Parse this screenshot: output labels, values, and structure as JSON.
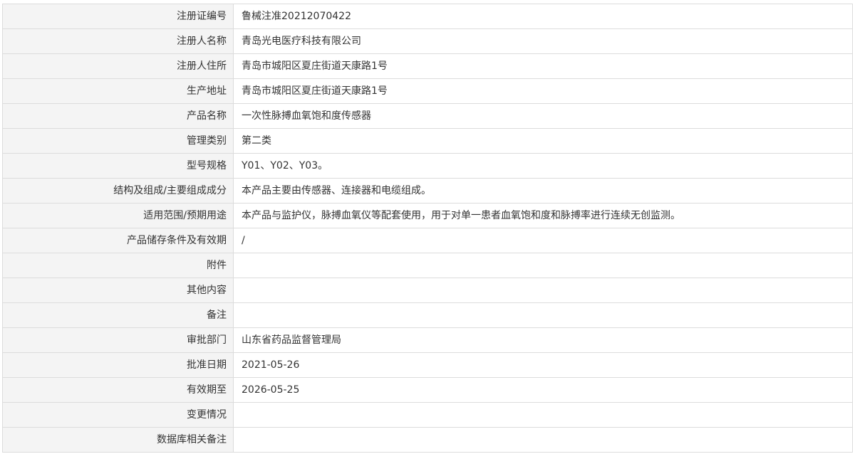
{
  "record": {
    "rows": [
      {
        "label": "注册证编号",
        "value": "鲁械注准20212070422"
      },
      {
        "label": "注册人名称",
        "value": "青岛光电医疗科技有限公司"
      },
      {
        "label": "注册人住所",
        "value": "青岛市城阳区夏庄街道天康路1号"
      },
      {
        "label": "生产地址",
        "value": "青岛市城阳区夏庄街道天康路1号"
      },
      {
        "label": "产品名称",
        "value": "一次性脉搏血氧饱和度传感器"
      },
      {
        "label": "管理类别",
        "value": "第二类"
      },
      {
        "label": "型号规格",
        "value": "Y01、Y02、Y03。"
      },
      {
        "label": "结构及组成/主要组成成分",
        "value": "本产品主要由传感器、连接器和电缆组成。"
      },
      {
        "label": "适用范围/预期用途",
        "value": "本产品与监护仪，脉搏血氧仪等配套使用，用于对单一患者血氧饱和度和脉搏率进行连续无创监测。"
      },
      {
        "label": "产品储存条件及有效期",
        "value": "/"
      },
      {
        "label": "附件",
        "value": ""
      },
      {
        "label": "其他内容",
        "value": ""
      },
      {
        "label": "备注",
        "value": ""
      },
      {
        "label": "审批部门",
        "value": "山东省药品监督管理局"
      },
      {
        "label": "批准日期",
        "value": "2021-05-26"
      },
      {
        "label": "有效期至",
        "value": "2026-05-25"
      },
      {
        "label": "变更情况",
        "value": ""
      },
      {
        "label": "数据库相关备注",
        "value": ""
      }
    ]
  }
}
